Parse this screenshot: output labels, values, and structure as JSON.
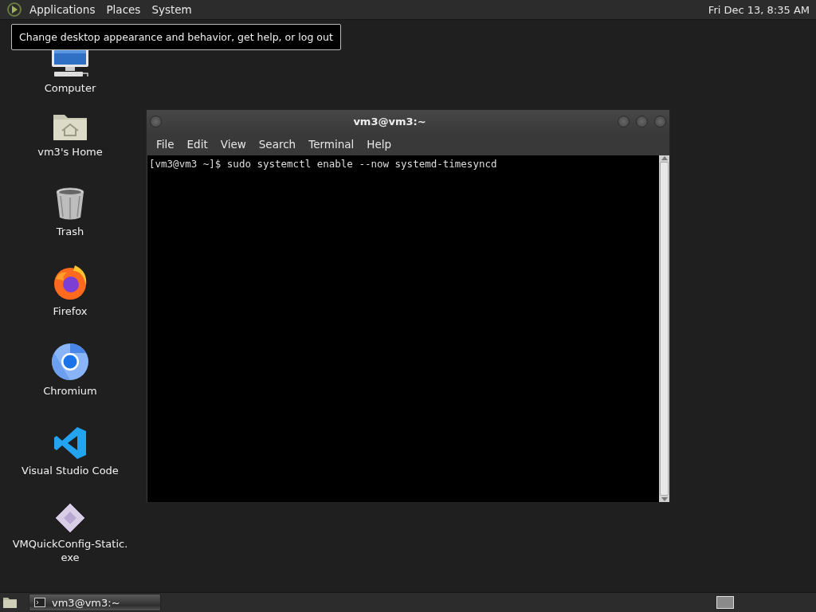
{
  "top_panel": {
    "menus": [
      "Applications",
      "Places",
      "System"
    ],
    "clock": "Fri Dec 13,  8:35 AM"
  },
  "tooltip": "Change desktop appearance and behavior, get help, or log out",
  "desktop_icons": [
    {
      "label": "Computer",
      "kind": "computer"
    },
    {
      "label": "vm3's Home",
      "kind": "home"
    },
    {
      "label": "Trash",
      "kind": "trash"
    },
    {
      "label": "Firefox",
      "kind": "firefox"
    },
    {
      "label": "Chromium",
      "kind": "chromium"
    },
    {
      "label": "Visual Studio Code",
      "kind": "vscode"
    },
    {
      "label": "VMQuickConfig-Static.exe",
      "kind": "exe"
    }
  ],
  "terminal_window": {
    "title": "vm3@vm3:~",
    "menu": [
      "File",
      "Edit",
      "View",
      "Search",
      "Terminal",
      "Help"
    ],
    "lines": [
      "[vm3@vm3 ~]$ sudo systemctl enable --now systemd-timesyncd"
    ]
  },
  "bottom_panel": {
    "tasks": [
      {
        "label": "vm3@vm3:~",
        "selected": true
      }
    ]
  }
}
